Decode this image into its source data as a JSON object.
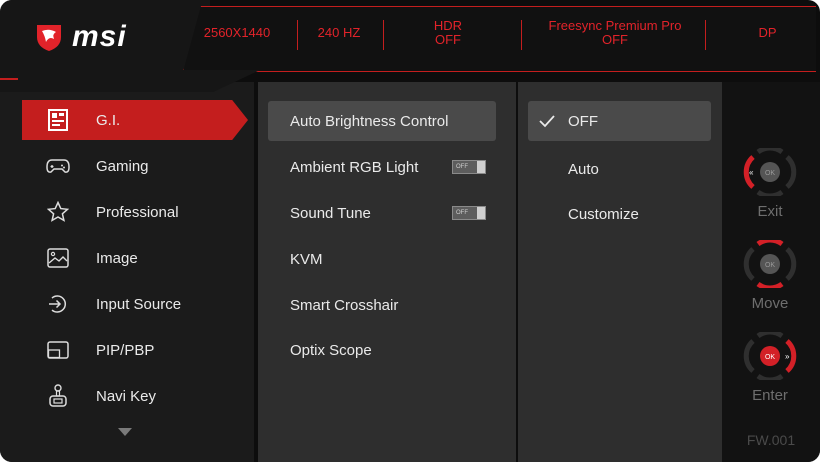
{
  "brand": {
    "name": "msi"
  },
  "header": {
    "resolution": "2560X1440",
    "refresh": "240 HZ",
    "hdr_line1": "HDR",
    "hdr_line2": "OFF",
    "freesync_line1": "Freesync Premium Pro",
    "freesync_line2": "OFF",
    "input": "DP"
  },
  "sidebar": {
    "items": [
      {
        "label": "G.I.",
        "icon": "gaming-intelligence-icon",
        "active": true
      },
      {
        "label": "Gaming",
        "icon": "gamepad-icon"
      },
      {
        "label": "Professional",
        "icon": "star-icon"
      },
      {
        "label": "Image",
        "icon": "image-icon"
      },
      {
        "label": "Input Source",
        "icon": "input-source-icon"
      },
      {
        "label": "PIP/PBP",
        "icon": "pip-icon"
      },
      {
        "label": "Navi Key",
        "icon": "joystick-icon"
      }
    ]
  },
  "submenu": {
    "items": [
      {
        "label": "Auto Brightness Control",
        "active": true
      },
      {
        "label": "Ambient RGB Light",
        "toggle": "OFF"
      },
      {
        "label": "Sound Tune",
        "toggle": "OFF"
      },
      {
        "label": "KVM"
      },
      {
        "label": "Smart Crosshair"
      },
      {
        "label": "Optix Scope"
      }
    ]
  },
  "options": {
    "items": [
      {
        "label": "OFF",
        "selected": true
      },
      {
        "label": "Auto"
      },
      {
        "label": "Customize"
      }
    ]
  },
  "navkeys": [
    {
      "label": "Exit",
      "center": "OK"
    },
    {
      "label": "Move",
      "center": "OK"
    },
    {
      "label": "Enter",
      "center": "OK"
    }
  ],
  "firmware": "FW.001",
  "colors": {
    "accent": "#c41e1e",
    "panel": "#2e2e2e",
    "sidebar": "#1b1b1b"
  }
}
